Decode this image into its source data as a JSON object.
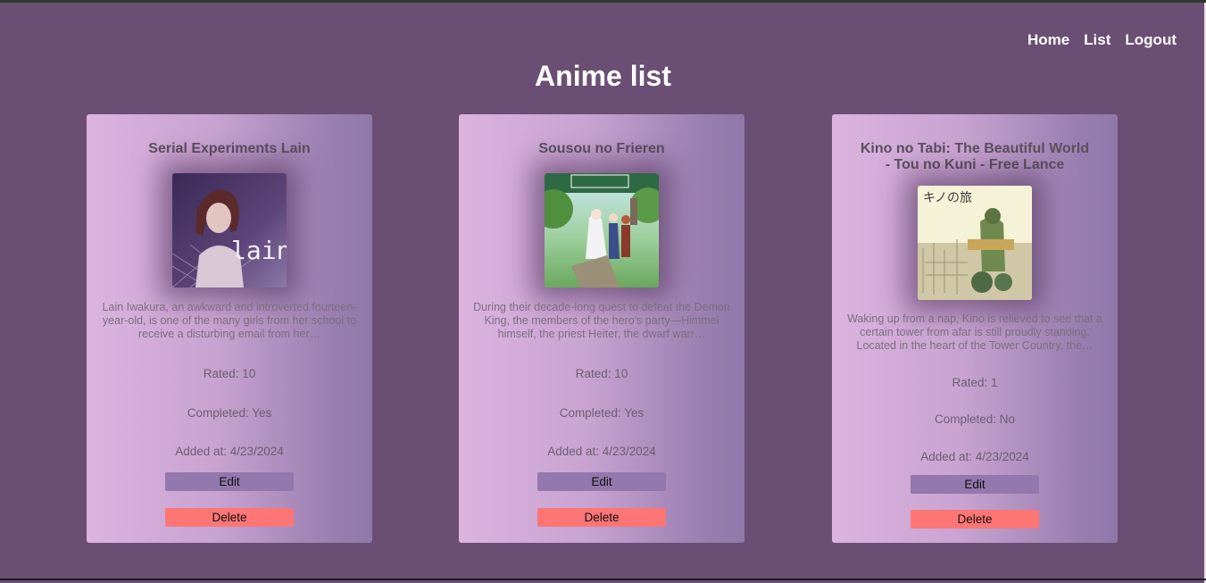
{
  "nav": {
    "home": "Home",
    "list": "List",
    "logout": "Logout"
  },
  "page": {
    "title": "Anime list"
  },
  "labels": {
    "edit": "Edit",
    "delete": "Delete"
  },
  "cards": [
    {
      "title": "Serial Experiments Lain",
      "poster_text": "lain",
      "description": "Lain Iwakura, an awkward and introverted fourteen-year-old, is one of the many girls from her school to receive a disturbing email from her…",
      "rated": "Rated: 10",
      "completed": "Completed: Yes",
      "added": "Added at: 4/23/2024"
    },
    {
      "title": "Sousou no Frieren",
      "poster_text": "",
      "description": "During their decade-long quest to defeat the Demon King, the members of the hero's party—Himmel himself, the priest Heiter, the dwarf warr…",
      "rated": "Rated: 10",
      "completed": "Completed: Yes",
      "added": "Added at: 4/23/2024"
    },
    {
      "title": "Kino no Tabi: The Beautiful World - Tou no Kuni - Free Lance",
      "poster_text": "キノの旅",
      "description": "Waking up from a nap, Kino is relieved to see that a certain tower from afar is still proudly standing. Located in the heart of the Tower Country, the…",
      "rated": "Rated: 1",
      "completed": "Completed: No",
      "added": "Added at: 4/23/2024"
    }
  ],
  "colors": {
    "background": "#6b4e73",
    "card_gradient_start": "#dcb3df",
    "card_gradient_end": "#8f78aa",
    "edit_button": "#9278ac",
    "delete_button": "#fd7575"
  }
}
